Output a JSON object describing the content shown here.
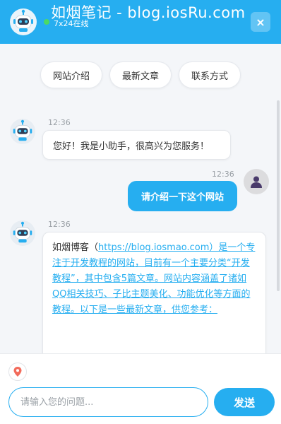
{
  "header": {
    "title": "如烟笔记 - blog.iosRu.com",
    "status": "7x24在线",
    "close_label": "×"
  },
  "quick_replies": [
    "网站介绍",
    "最新文章",
    "联系方式"
  ],
  "messages": [
    {
      "sender": "bot",
      "time": "12:36",
      "text": "您好！我是小助手，很高兴为您服务！"
    },
    {
      "sender": "user",
      "time": "12:36",
      "text": "请介绍一下这个网站"
    },
    {
      "sender": "bot",
      "time": "12:36",
      "text_prefix": "如烟博客（",
      "link_text": "https://blog.iosmao.com）是一个专注于开发教程的网站，目前有一个主要分类“开发教程”，其中包含5篇文章。网站内容涵盖了诸如QQ相关技巧、子比主题美化、功能优化等方面的教程。以下是一些最新文章，供您参考："
    }
  ],
  "input": {
    "placeholder": "请输入您的问题..."
  },
  "send_label": "发送",
  "colors": {
    "accent": "#26aef0",
    "online": "#4cd964"
  },
  "icons": {
    "bot_avatar": "robot-icon",
    "user_avatar": "user-icon",
    "location": "location-pin-icon"
  }
}
